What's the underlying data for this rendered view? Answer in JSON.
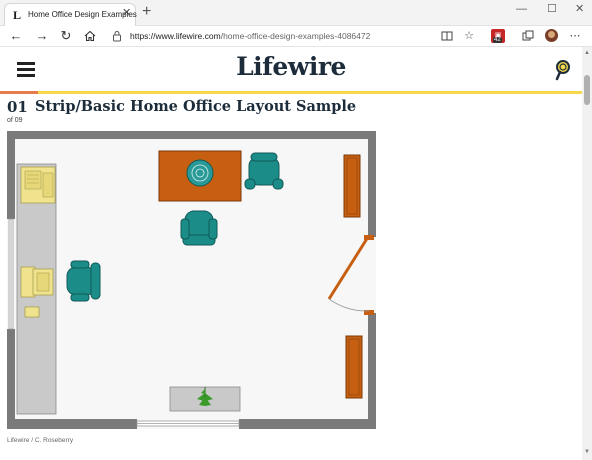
{
  "browser": {
    "tab_title": "Home Office Design Examples",
    "tab_favicon": "L",
    "url_host": "https://www.lifewire.com",
    "url_path": "/home-office-design-examples-4086472",
    "extension_badge_count": "42",
    "icons": {
      "back": "back-arrow-icon",
      "forward": "forward-arrow-icon",
      "refresh": "refresh-icon",
      "home": "home-icon",
      "lock": "lock-icon",
      "reader": "reader-view-icon",
      "favorite": "favorite-star-icon",
      "collections": "collections-icon",
      "menu": "more-menu-icon"
    }
  },
  "site": {
    "logo": "Lifewire",
    "rule_color": "#f5d94b",
    "accent_color": "#e87b4c",
    "logo_color": "#1c2c3a"
  },
  "article": {
    "number": "01",
    "title": "Strip/Basic Home Office Layout Sample",
    "position": "of 09",
    "caption": "Lifewire / C. Roseberry"
  },
  "floorplan": {
    "colors": {
      "wall": "#7a7a7a",
      "floor": "#f7f7f7",
      "desk": "#c9c9c9",
      "wood": "#c65f12",
      "chair": "#1b8c88",
      "cushion": "#efe38e",
      "plant": "#3a9a2a"
    }
  }
}
